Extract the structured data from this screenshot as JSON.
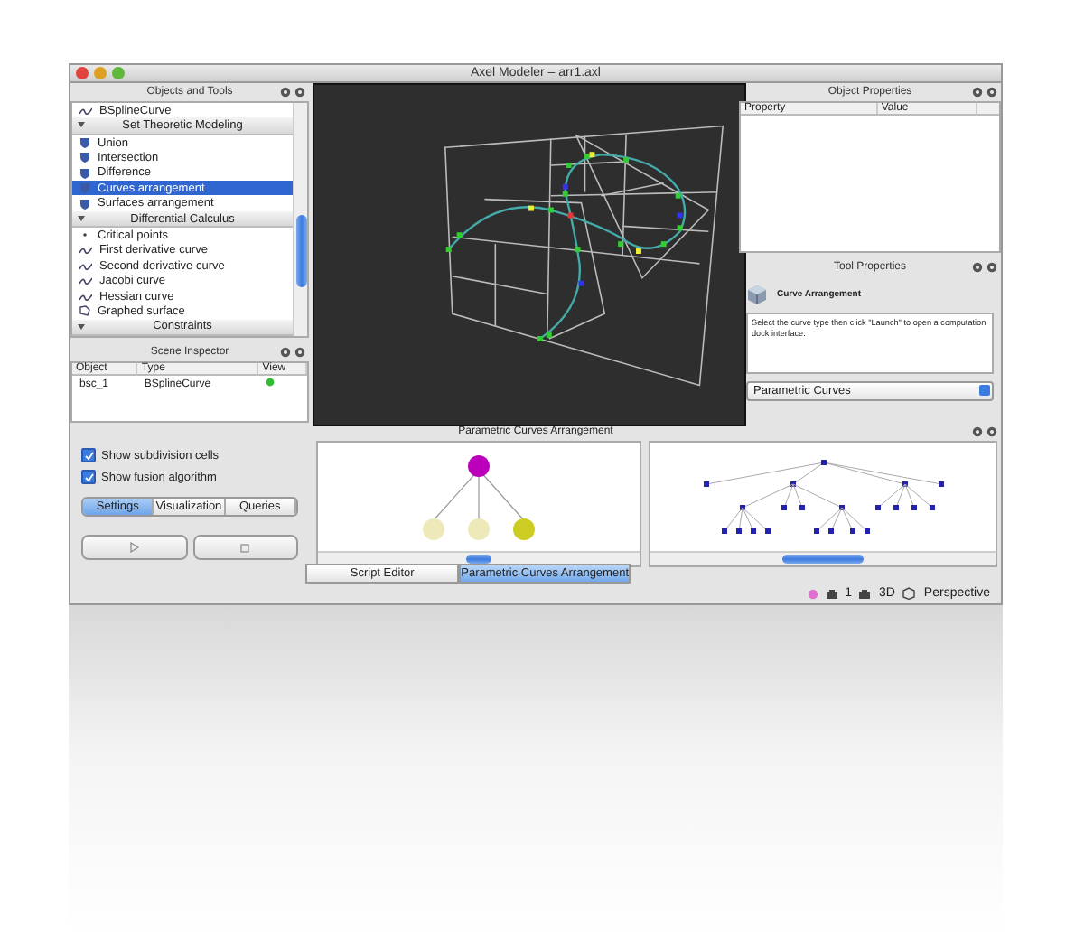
{
  "window": {
    "title": "Axel Modeler – arr1.axl"
  },
  "objects_panel": {
    "title": "Objects and Tools",
    "items": [
      {
        "kind": "curve",
        "label": "BSplineCurve",
        "selected": false
      },
      {
        "kind": "group",
        "label": "Set Theoretic Modeling",
        "selected": false
      },
      {
        "kind": "operation",
        "label": "Union",
        "selected": false
      },
      {
        "kind": "operation",
        "label": "Intersection",
        "selected": false
      },
      {
        "kind": "operation",
        "label": "Difference",
        "selected": false
      },
      {
        "kind": "operation",
        "label": "Curves arrangement",
        "selected": true
      },
      {
        "kind": "operation",
        "label": "Surfaces arrangement",
        "selected": false
      },
      {
        "kind": "group",
        "label": "Differential Calculus",
        "selected": false
      },
      {
        "kind": "point",
        "label": "Critical points",
        "selected": false
      },
      {
        "kind": "curve",
        "label": "First derivative curve",
        "selected": false
      },
      {
        "kind": "curve",
        "label": "Second derivative curve",
        "selected": false
      },
      {
        "kind": "curve",
        "label": "Jacobi curve",
        "selected": false
      },
      {
        "kind": "curve",
        "label": "Hessian curve",
        "selected": false
      },
      {
        "kind": "surface",
        "label": "Graphed surface",
        "selected": false
      },
      {
        "kind": "group",
        "label": "Constraints",
        "selected": false
      }
    ]
  },
  "scene_inspector": {
    "title": "Scene Inspector",
    "columns": [
      "Object",
      "Type",
      "View"
    ],
    "rows": [
      {
        "object": "bsc_1",
        "type": "BSplineCurve",
        "visible": true
      }
    ]
  },
  "object_properties": {
    "title": "Object Properties",
    "columns": [
      "Property",
      "Value"
    ]
  },
  "tool_properties": {
    "title": "Tool Properties",
    "tool_name": "Curve Arrangement",
    "description": "Select the curve type then click \"Launch\" to open a computation dock interface.",
    "dropdown": "Parametric Curves"
  },
  "dock": {
    "title": "Parametric Curves Arrangement",
    "checkboxes": [
      {
        "label": "Show subdivision cells",
        "checked": true
      },
      {
        "label": "Show fusion algorithm",
        "checked": true
      }
    ],
    "segments": [
      {
        "label": "Settings",
        "selected": true
      },
      {
        "label": "Visualization",
        "selected": false
      },
      {
        "label": "Queries",
        "selected": false
      }
    ],
    "tabs": [
      {
        "label": "Script Editor",
        "selected": false
      },
      {
        "label": "Parametric Curves Arrangement",
        "selected": true
      }
    ]
  },
  "status_bar": {
    "count": "1",
    "mode": "3D",
    "projection": "Perspective"
  }
}
